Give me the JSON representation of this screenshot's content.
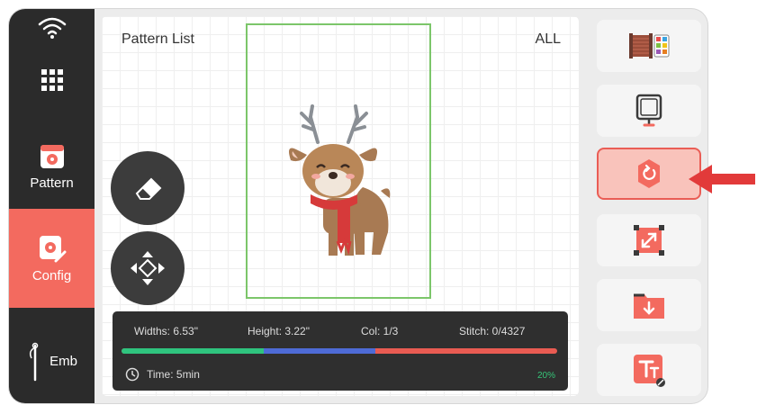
{
  "sidebar": {
    "items": [
      {
        "label": "Pattern"
      },
      {
        "label": "Config"
      },
      {
        "label": "Emb"
      }
    ]
  },
  "main": {
    "title": "Pattern List",
    "filter": "ALL"
  },
  "info": {
    "widths": "Widths: 6.53\"",
    "height": "Height: 3.22\"",
    "col": "Col: 1/3",
    "stitch": "Stitch: 0/4327",
    "time": "Time: 5min",
    "percent": "20%",
    "progress": 0.2
  },
  "colors": {
    "accent": "#f36a5f",
    "hoop_border": "#7cc66a",
    "progress_green": "#2fc47e",
    "progress_blue": "#4e6bd6",
    "progress_red": "#e95b52"
  },
  "icons": {
    "sidebar": [
      "wifi-icon",
      "app-grid-icon",
      "pattern-icon",
      "config-icon",
      "needle-icon"
    ],
    "right_panel": [
      "thread-color-icon",
      "hoop-icon",
      "rotate-icon",
      "resize-icon",
      "import-icon",
      "text-icon"
    ],
    "floating": [
      "eraser-icon",
      "move-icon"
    ]
  }
}
